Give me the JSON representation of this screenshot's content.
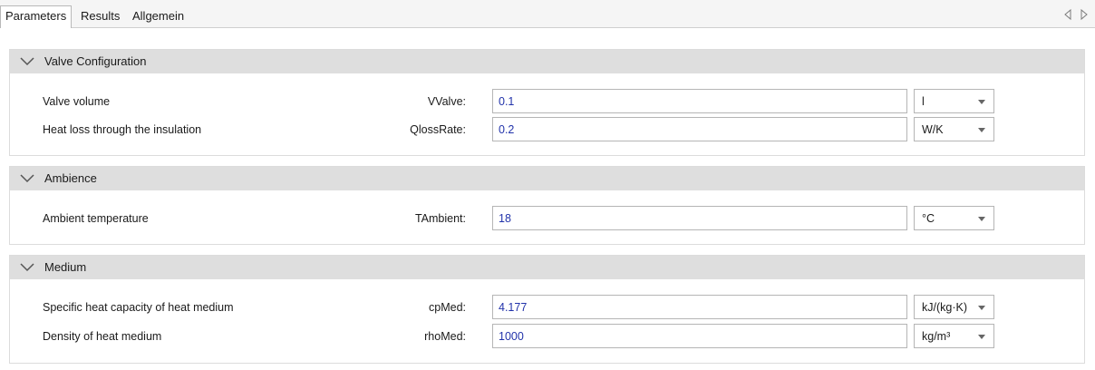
{
  "tabs": [
    {
      "label": "Parameters",
      "active": true
    },
    {
      "label": "Results",
      "active": false
    },
    {
      "label": "Allgemein",
      "active": false
    }
  ],
  "icons": {
    "tab_prev": "triangle-left-icon",
    "tab_next": "triangle-right-icon",
    "section_toggle": "chevron-down-icon",
    "unit_dropdown": "caret-down-icon"
  },
  "colors": {
    "section_header_bg": "#dedede",
    "input_value_text": "#2233aa",
    "border": "#b5b5b5"
  },
  "sections": [
    {
      "title": "Valve Configuration",
      "rows": [
        {
          "label": "Valve volume",
          "var": "VValve:",
          "value": "0.1",
          "unit": "l"
        },
        {
          "label": "Heat loss through the insulation",
          "var": "QlossRate:",
          "value": "0.2",
          "unit": "W/K"
        }
      ]
    },
    {
      "title": "Ambience",
      "rows": [
        {
          "label": "Ambient temperature",
          "var": "TAmbient:",
          "value": "18",
          "unit": "°C"
        }
      ]
    },
    {
      "title": "Medium",
      "rows": [
        {
          "label": "Specific heat capacity of heat medium",
          "var": "cpMed:",
          "value": "4.177",
          "unit": "kJ/(kg·K)"
        },
        {
          "label": "Density of heat medium",
          "var": "rhoMed:",
          "value": "1000",
          "unit": "kg/m³"
        }
      ]
    }
  ]
}
